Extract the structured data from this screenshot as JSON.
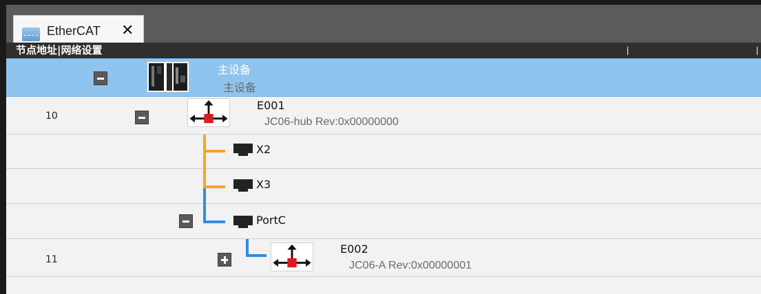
{
  "tab": {
    "label": "EtherCAT",
    "close": "✕"
  },
  "header": {
    "title": "节点地址|网络设置"
  },
  "tree": {
    "master": {
      "name": "主设备",
      "model": "主设备"
    },
    "e001": {
      "address": "10",
      "name": "E001",
      "model": "JC06-hub Rev:0x00000000"
    },
    "x2": {
      "name": "X2"
    },
    "x3": {
      "name": "X3"
    },
    "portc": {
      "name": "PortC"
    },
    "e002": {
      "address": "11",
      "name": "E002",
      "model": "JC06-A Rev:0x00000001"
    }
  },
  "colors": {
    "selected_row": "#8fc4ef",
    "connector_orange": "#f5a623",
    "connector_blue": "#2f8ce6"
  },
  "icons": [
    "ethercat-icon",
    "close-icon",
    "collapse-icon",
    "expand-icon",
    "master-device-icon",
    "slave-device-icon",
    "port-icon"
  ]
}
